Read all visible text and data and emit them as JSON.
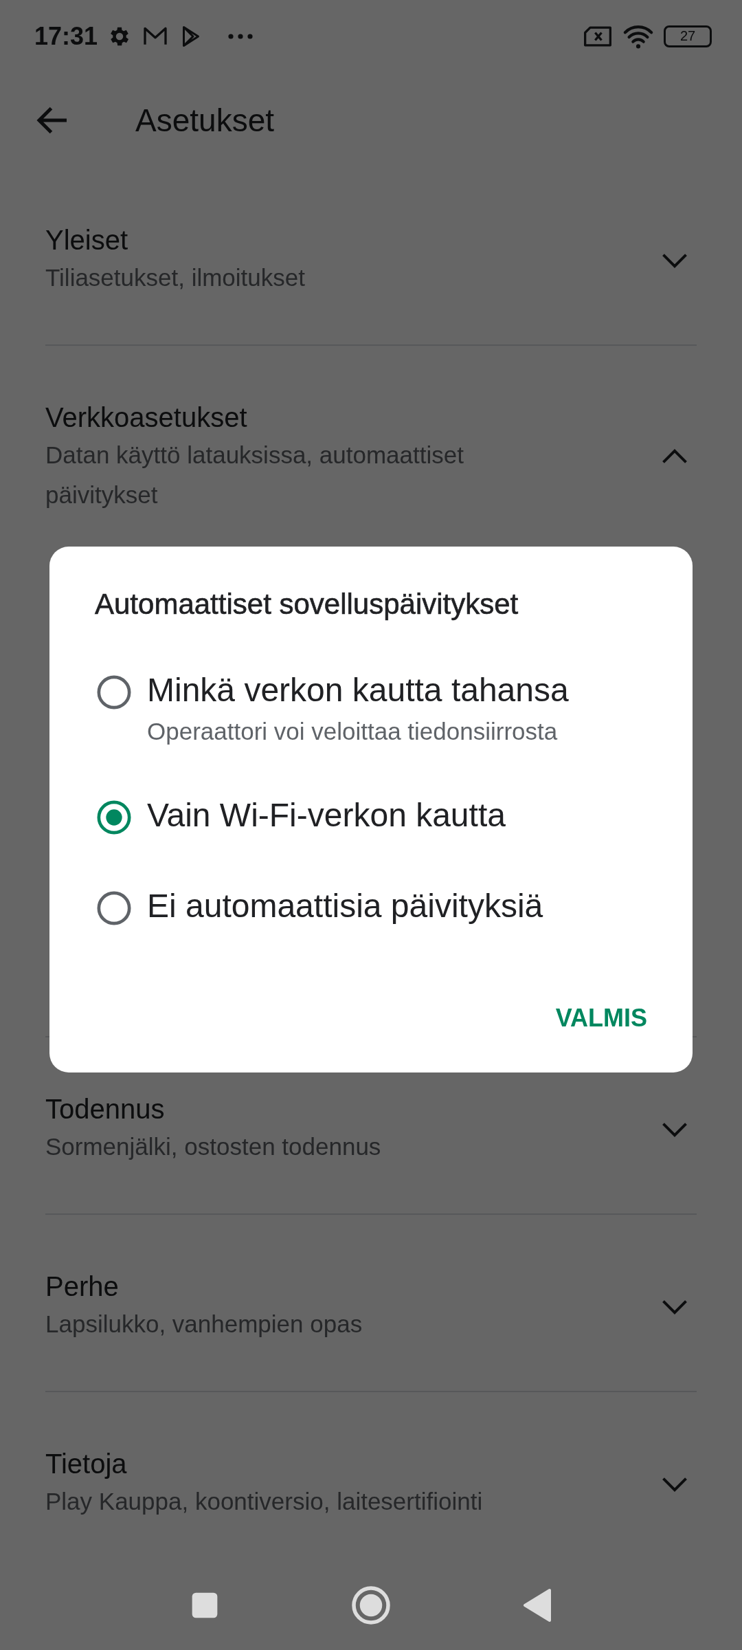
{
  "status_bar": {
    "time": "17:31",
    "battery": "27"
  },
  "top_bar": {
    "title": "Asetukset"
  },
  "sections": [
    {
      "title": "Yleiset",
      "subtitle": "Tiliasetukset, ilmoitukset",
      "expanded": false
    },
    {
      "title": "Verkkoasetukset",
      "subtitle": "Datan käyttö latauksissa, automaattiset päivitykset",
      "expanded": true
    },
    {
      "title": "Todennus",
      "subtitle": "Sormenjälki, ostosten todennus",
      "expanded": false
    },
    {
      "title": "Perhe",
      "subtitle": "Lapsilukko, vanhempien opas",
      "expanded": false
    },
    {
      "title": "Tietoja",
      "subtitle": "Play Kauppa, koontiversio, laitesertifiointi",
      "expanded": false
    }
  ],
  "dialog": {
    "title": "Automaattiset sovelluspäivitykset",
    "options": [
      {
        "label": "Minkä verkon kautta tahansa",
        "hint": "Operaattori voi veloittaa tiedonsiirrosta",
        "selected": false
      },
      {
        "label": "Vain Wi-Fi-verkon kautta",
        "selected": true
      },
      {
        "label": "Ei automaattisia päivityksiä",
        "selected": false
      }
    ],
    "button": "VALMIS"
  }
}
